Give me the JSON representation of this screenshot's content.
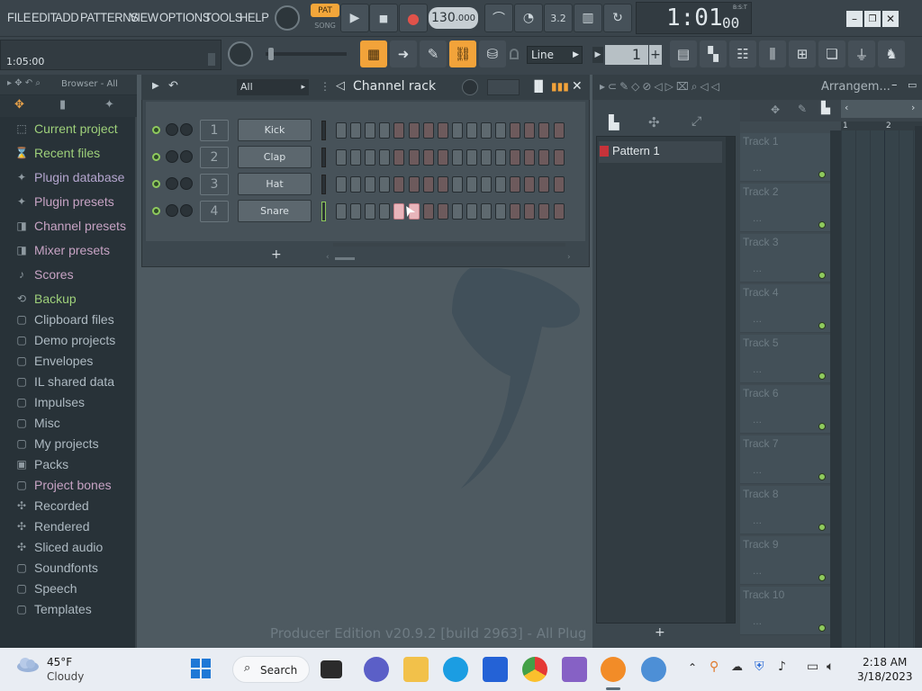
{
  "menu": [
    "FILE",
    "EDIT",
    "ADD",
    "PATTERNS",
    "VIEW",
    "OPTIONS",
    "TOOLS",
    "HELP"
  ],
  "transport": {
    "pat_label": "PAT",
    "song_label": "SONG",
    "tempo": "130",
    "tempo_frac": ".000",
    "time": "1:01",
    "time_small": "00",
    "time_mode": "B:S:T"
  },
  "hint": {
    "time": "1:05:00"
  },
  "toolbar2": {
    "snap": "Line",
    "pattern_num": "1"
  },
  "browser": {
    "title": "Browser - All",
    "items": [
      {
        "label": "Current project",
        "style": "on"
      },
      {
        "label": "Recent files",
        "style": "on"
      },
      {
        "label": "Plugin database",
        "style": "pl"
      },
      {
        "label": "Plugin presets",
        "style": "pr"
      },
      {
        "label": "Channel presets",
        "style": "pr"
      },
      {
        "label": "Mixer presets",
        "style": "pr"
      },
      {
        "label": "Scores",
        "style": "pr"
      },
      {
        "label": "Backup",
        "style": "on"
      },
      {
        "label": "Clipboard files",
        "style": ""
      },
      {
        "label": "Demo projects",
        "style": ""
      },
      {
        "label": "Envelopes",
        "style": ""
      },
      {
        "label": "IL shared data",
        "style": ""
      },
      {
        "label": "Impulses",
        "style": ""
      },
      {
        "label": "Misc",
        "style": ""
      },
      {
        "label": "My projects",
        "style": ""
      },
      {
        "label": "Packs",
        "style": ""
      },
      {
        "label": "Project bones",
        "style": "pr"
      },
      {
        "label": "Recorded",
        "style": ""
      },
      {
        "label": "Rendered",
        "style": ""
      },
      {
        "label": "Sliced audio",
        "style": ""
      },
      {
        "label": "Soundfonts",
        "style": ""
      },
      {
        "label": "Speech",
        "style": ""
      },
      {
        "label": "Templates",
        "style": ""
      }
    ]
  },
  "rack": {
    "filter": "All",
    "title": "Channel rack",
    "add_label": "+",
    "channels": [
      {
        "num": "1",
        "name": "Kick"
      },
      {
        "num": "2",
        "name": "Clap"
      },
      {
        "num": "3",
        "name": "Hat"
      },
      {
        "num": "4",
        "name": "Snare"
      }
    ]
  },
  "watermark": "Producer Edition v20.9.2 [build 2963] - All Plug",
  "playlist": {
    "title": "Arrangem...",
    "pattern": "Pattern 1",
    "add_label": "+",
    "ruler": [
      "1",
      "2"
    ],
    "tracks": [
      "Track 1",
      "Track 2",
      "Track 3",
      "Track 4",
      "Track 5",
      "Track 6",
      "Track 7",
      "Track 8",
      "Track 9",
      "Track 10"
    ]
  },
  "taskbar": {
    "temp": "45°F",
    "weather": "Cloudy",
    "search": "Search",
    "clock_time": "2:18 AM",
    "clock_date": "3/18/2023"
  }
}
